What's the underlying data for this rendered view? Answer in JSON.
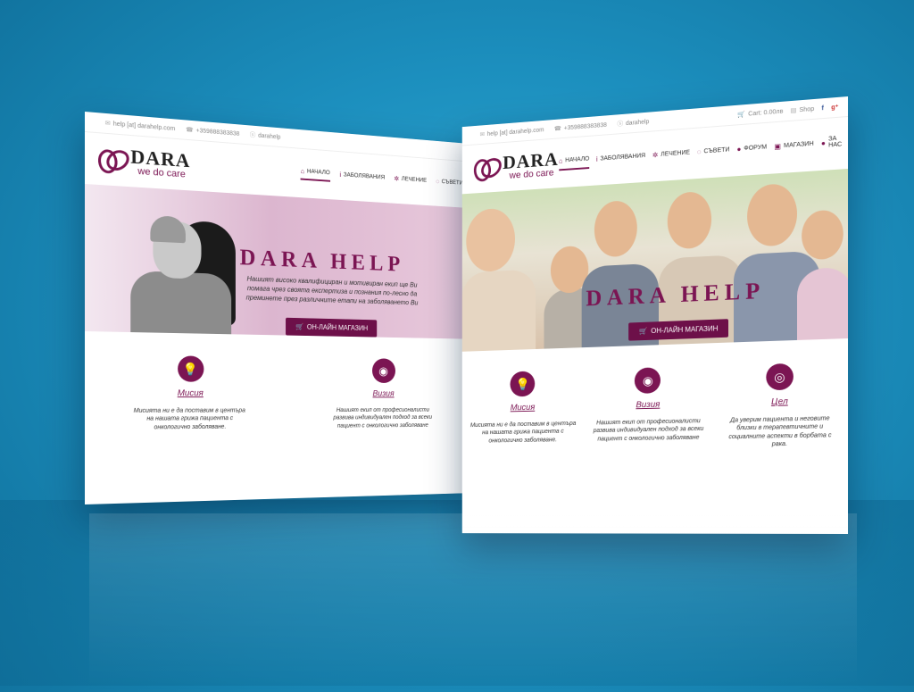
{
  "topbar": {
    "email": "help [at] darahelp.com",
    "phone": "+359888383838",
    "skype": "darahelp",
    "cart": "Cart: 0.00лв",
    "shop": "Shop"
  },
  "brand": {
    "name": "DARA",
    "tagline": "we do care"
  },
  "nav_left": [
    {
      "label": "НАЧАЛО",
      "icon": "home-icon"
    },
    {
      "label": "ЗАБОЛЯВАНИЯ",
      "icon": "info-icon"
    },
    {
      "label": "ЛЕЧЕНИЕ",
      "icon": "gear-icon"
    },
    {
      "label": "СЪВЕТИ",
      "icon": "chat-icon"
    }
  ],
  "nav_right": [
    {
      "label": "НАЧАЛО",
      "icon": "home-icon"
    },
    {
      "label": "ЗАБОЛЯВАНИЯ",
      "icon": "info-icon"
    },
    {
      "label": "ЛЕЧЕНИЕ",
      "icon": "gear-icon"
    },
    {
      "label": "СЪВЕТИ",
      "icon": "chat-icon"
    },
    {
      "label": "ФОРУМ",
      "icon": "users-icon"
    },
    {
      "label": "МАГАЗИН",
      "icon": "bag-icon"
    },
    {
      "label": "ЗА НАС",
      "icon": "people-icon"
    }
  ],
  "hero": {
    "title": "DARA HELP",
    "text": "Нашият високо квалифициран и мотивиран екип ще Ви помага чрез своята експертиза и познания по-лесно да преминете през различните етапи на заболяването Ви",
    "shop_button": "ОН-ЛАЙН МАГАЗИН"
  },
  "features": [
    {
      "title": "Мисия",
      "icon": "lightbulb-icon",
      "text": "Мисията ни е да поставим в центъра на нашата грижа пациента с онкологично заболяване."
    },
    {
      "title": "Визия",
      "icon": "eye-icon",
      "text": "Нашият екип от професионалисти развива индивидуален подход за всеки пациент с онкологично заболяване"
    },
    {
      "title": "Цел",
      "icon": "target-icon",
      "text": "Да уверим пациента и неговите близки в терапевтичните и социалните аспекти в борбата с рака."
    }
  ],
  "colors": {
    "accent": "#7b1553",
    "background": "#1c8fbe"
  }
}
